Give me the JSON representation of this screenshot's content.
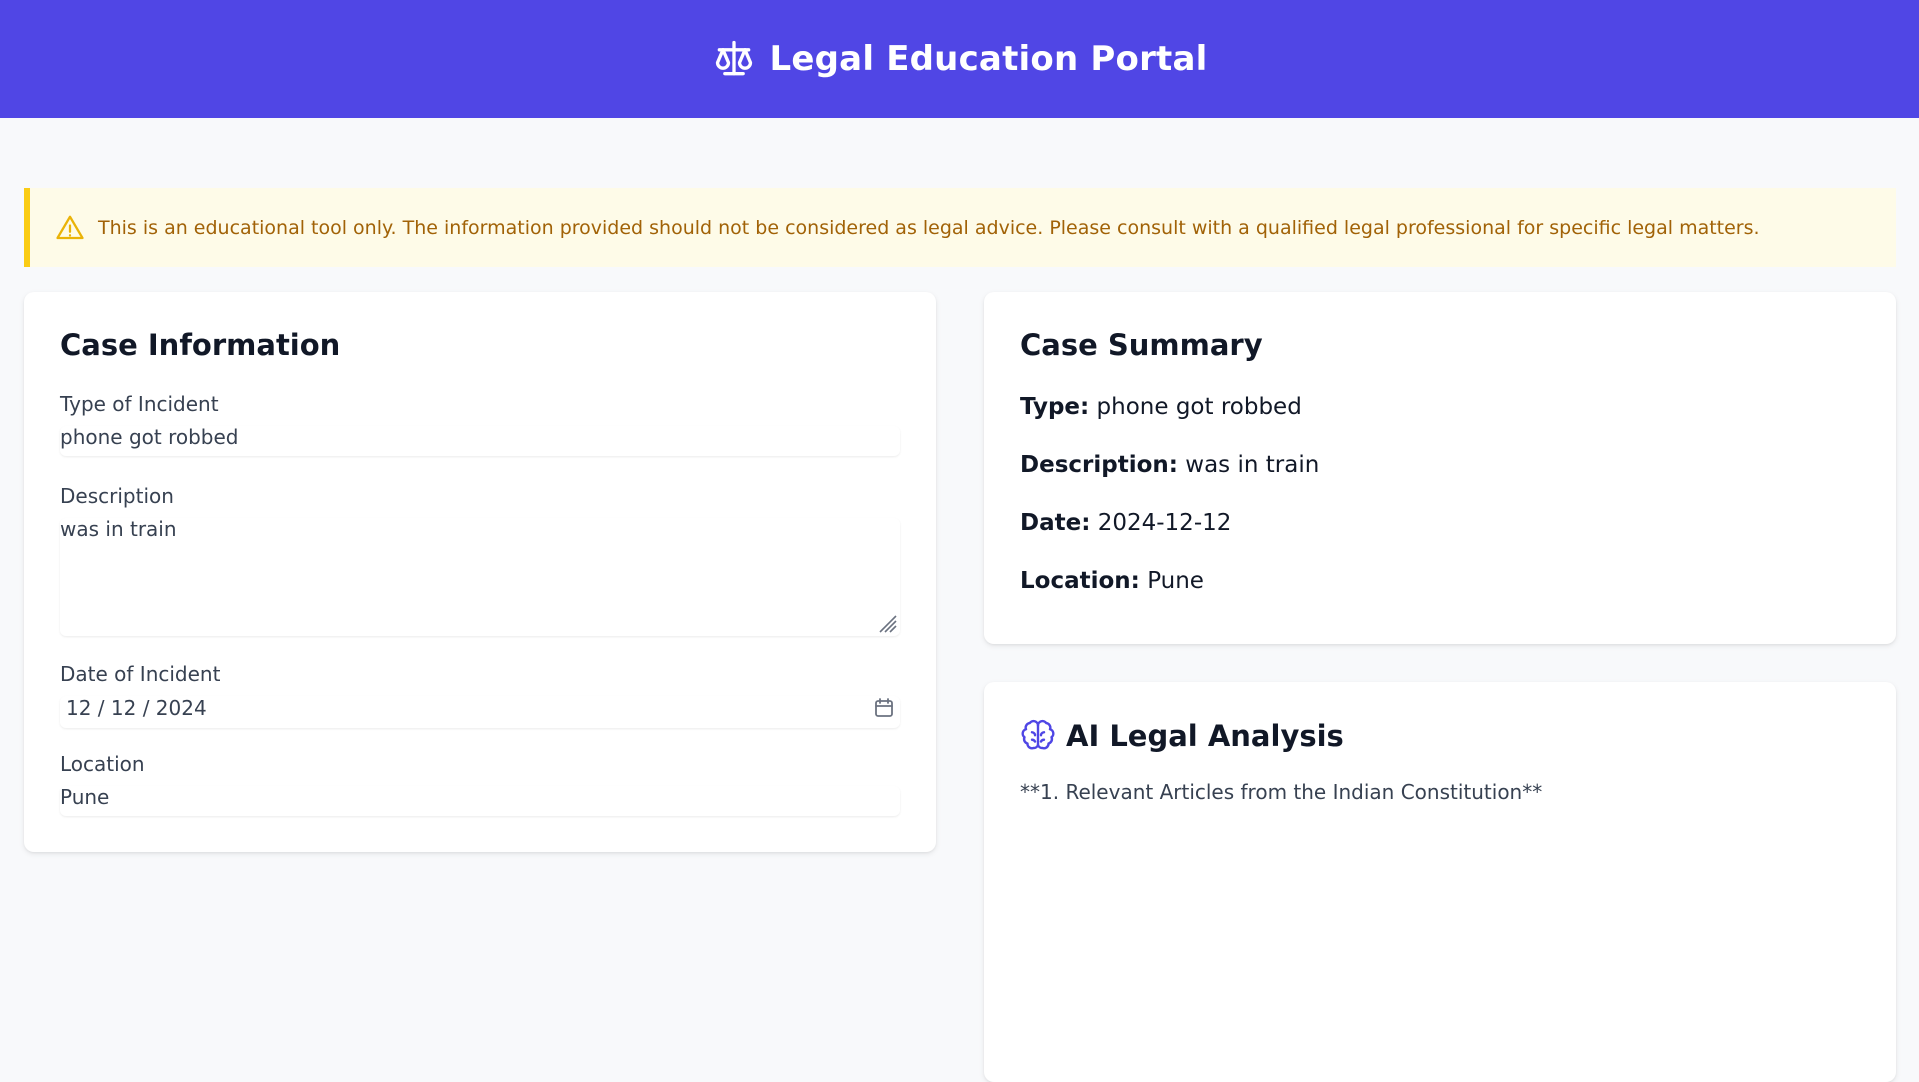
{
  "header": {
    "title": "Legal Education Portal",
    "icon": "scales-icon",
    "background": "#5046e5"
  },
  "disclaimer": {
    "icon": "warning-triangle-icon",
    "text": "This is an educational tool only. The information provided should not be considered as legal advice. Please consult with a qualified legal professional for specific legal matters.",
    "color": "#a16207",
    "accent": "#facc15"
  },
  "case_info": {
    "title": "Case Information",
    "type_label": "Type of Incident",
    "type_value": "phone got robbed",
    "description_label": "Description",
    "description_value": "was in train",
    "date_label": "Date of Incident",
    "date_value": "12 / 12 / 2024",
    "location_label": "Location",
    "location_value": "Pune"
  },
  "summary": {
    "title": "Case Summary",
    "type_label": "Type:",
    "type_value": "phone got robbed",
    "description_label": "Description:",
    "description_value": "was in train",
    "date_label": "Date:",
    "date_value": "2024-12-12",
    "location_label": "Location:",
    "location_value": "Pune"
  },
  "analysis": {
    "title": "AI Legal Analysis",
    "icon": "brain-icon",
    "first_line": "**1. Relevant Articles from the Indian Constitution**"
  }
}
